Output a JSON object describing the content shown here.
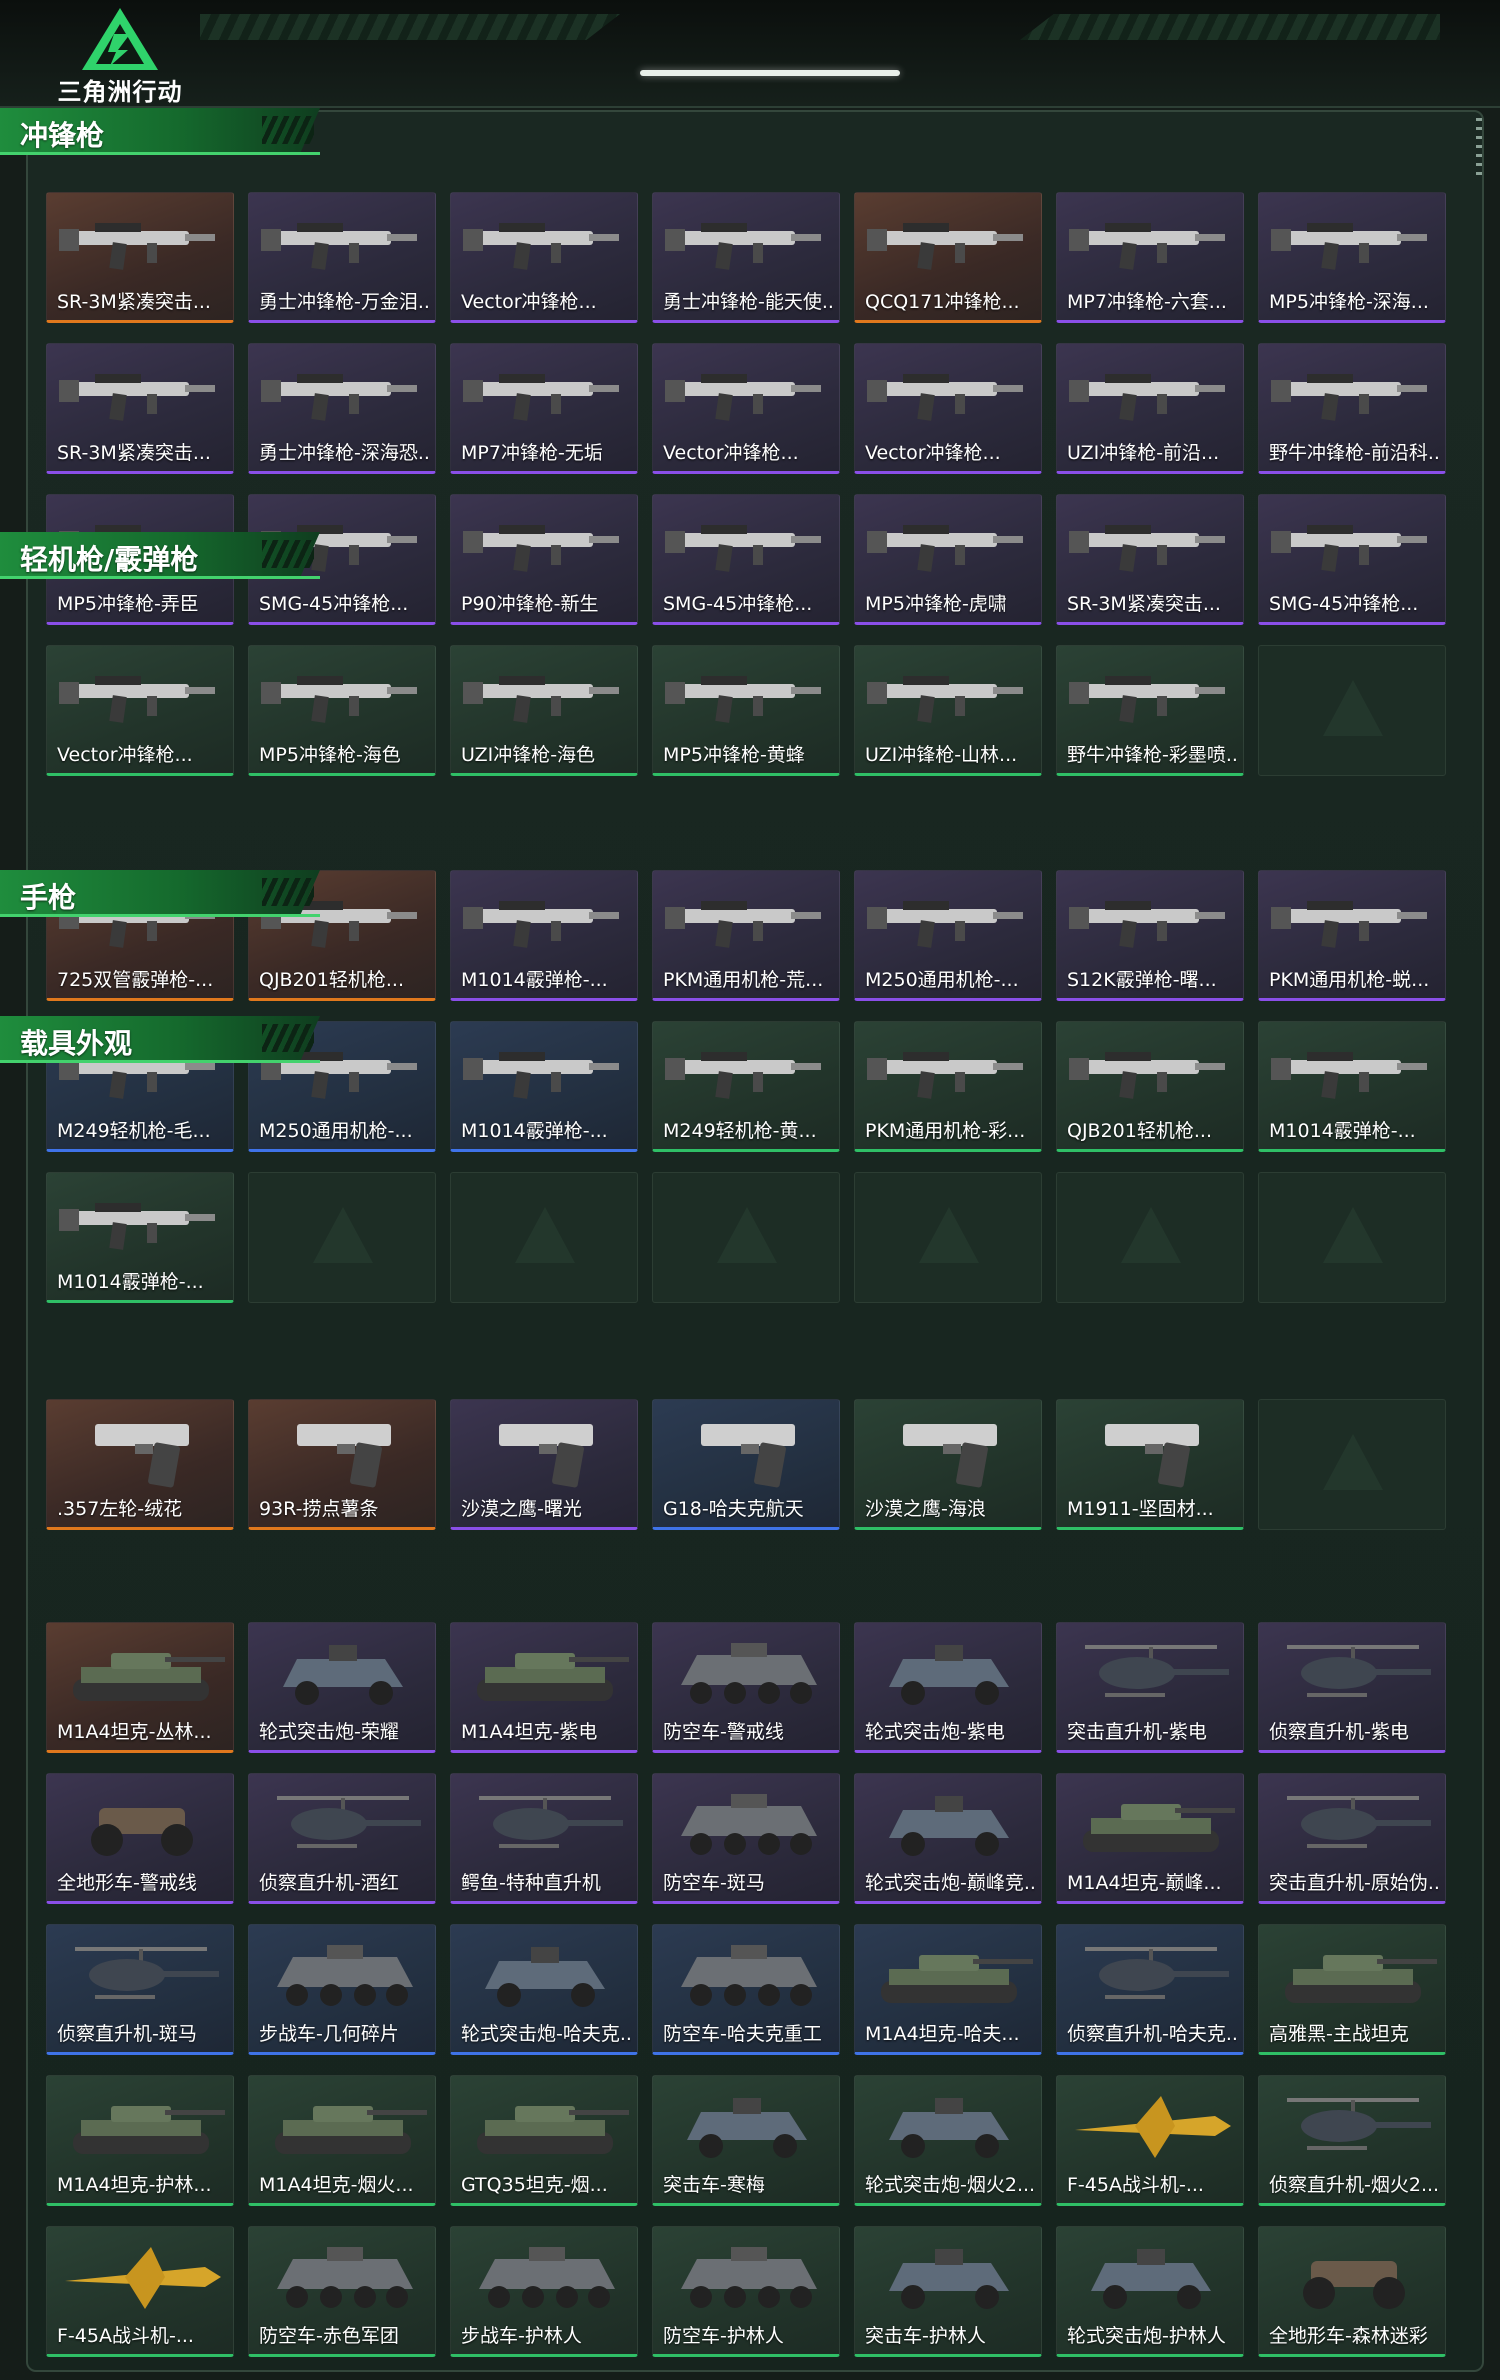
{
  "header": {
    "logo_text": "三角洲行动"
  },
  "colors": {
    "orange": "#e0781d",
    "purple": "#8a4fe8",
    "blue": "#3f73e8",
    "green": "#2fbf66",
    "accent": "#1f8d3d"
  },
  "sections": [
    {
      "title": "冲锋枪",
      "items": [
        {
          "name": "SR-3M紧凑突击...",
          "rarity": "orange",
          "icon": "rifle-icon"
        },
        {
          "name": "勇士冲锋枪-万金泪...",
          "rarity": "purple",
          "icon": "rifle-icon"
        },
        {
          "name": "Vector冲锋枪...",
          "rarity": "purple",
          "icon": "rifle-icon"
        },
        {
          "name": "勇士冲锋枪-能天使...",
          "rarity": "purple",
          "icon": "rifle-icon"
        },
        {
          "name": "QCQ171冲锋枪...",
          "rarity": "orange",
          "icon": "rifle-icon"
        },
        {
          "name": "MP7冲锋枪-六套...",
          "rarity": "purple",
          "icon": "rifle-icon"
        },
        {
          "name": "MP5冲锋枪-深海...",
          "rarity": "purple",
          "icon": "rifle-icon"
        },
        {
          "name": "SR-3M紧凑突击...",
          "rarity": "purple",
          "icon": "rifle-icon"
        },
        {
          "name": "勇士冲锋枪-深海恐...",
          "rarity": "purple",
          "icon": "rifle-icon"
        },
        {
          "name": "MP7冲锋枪-无垢",
          "rarity": "purple",
          "icon": "rifle-icon"
        },
        {
          "name": "Vector冲锋枪...",
          "rarity": "purple",
          "icon": "rifle-icon"
        },
        {
          "name": "Vector冲锋枪...",
          "rarity": "purple",
          "icon": "rifle-icon"
        },
        {
          "name": "UZI冲锋枪-前沿...",
          "rarity": "purple",
          "icon": "rifle-icon"
        },
        {
          "name": "野牛冲锋枪-前沿科...",
          "rarity": "purple",
          "icon": "rifle-icon"
        },
        {
          "name": "MP5冲锋枪-弄臣",
          "rarity": "purple",
          "icon": "rifle-icon"
        },
        {
          "name": "SMG-45冲锋枪...",
          "rarity": "purple",
          "icon": "rifle-icon"
        },
        {
          "name": "P90冲锋枪-新生",
          "rarity": "purple",
          "icon": "rifle-icon"
        },
        {
          "name": "SMG-45冲锋枪...",
          "rarity": "purple",
          "icon": "rifle-icon"
        },
        {
          "name": "MP5冲锋枪-虎啸",
          "rarity": "purple",
          "icon": "rifle-icon"
        },
        {
          "name": "SR-3M紧凑突击...",
          "rarity": "purple",
          "icon": "rifle-icon"
        },
        {
          "name": "SMG-45冲锋枪...",
          "rarity": "purple",
          "icon": "rifle-icon"
        },
        {
          "name": "Vector冲锋枪...",
          "rarity": "green",
          "icon": "rifle-icon"
        },
        {
          "name": "MP5冲锋枪-海色",
          "rarity": "green",
          "icon": "rifle-icon"
        },
        {
          "name": "UZI冲锋枪-海色",
          "rarity": "green",
          "icon": "rifle-icon"
        },
        {
          "name": "MP5冲锋枪-黄蜂",
          "rarity": "green",
          "icon": "rifle-icon"
        },
        {
          "name": "UZI冲锋枪-山林...",
          "rarity": "green",
          "icon": "rifle-icon"
        },
        {
          "name": "野牛冲锋枪-彩墨喷...",
          "rarity": "green",
          "icon": "rifle-icon"
        },
        {
          "name": "",
          "rarity": "empty",
          "icon": ""
        }
      ]
    },
    {
      "title": "轻机枪/霰弹枪",
      "items": [
        {
          "name": "725双管霰弹枪-...",
          "rarity": "orange",
          "icon": "rifle-icon"
        },
        {
          "name": "QJB201轻机枪...",
          "rarity": "orange",
          "icon": "rifle-icon"
        },
        {
          "name": "M1014霰弹枪-...",
          "rarity": "purple",
          "icon": "rifle-icon"
        },
        {
          "name": "PKM通用机枪-荒...",
          "rarity": "purple",
          "icon": "rifle-icon"
        },
        {
          "name": "M250通用机枪-...",
          "rarity": "purple",
          "icon": "rifle-icon"
        },
        {
          "name": "S12K霰弹枪-曙...",
          "rarity": "purple",
          "icon": "rifle-icon"
        },
        {
          "name": "PKM通用机枪-蜕...",
          "rarity": "purple",
          "icon": "rifle-icon"
        },
        {
          "name": "M249轻机枪-毛...",
          "rarity": "blue",
          "icon": "rifle-icon"
        },
        {
          "name": "M250通用机枪-...",
          "rarity": "blue",
          "icon": "rifle-icon"
        },
        {
          "name": "M1014霰弹枪-...",
          "rarity": "blue",
          "icon": "rifle-icon"
        },
        {
          "name": "M249轻机枪-黄...",
          "rarity": "green",
          "icon": "rifle-icon"
        },
        {
          "name": "PKM通用机枪-彩...",
          "rarity": "green",
          "icon": "rifle-icon"
        },
        {
          "name": "QJB201轻机枪...",
          "rarity": "green",
          "icon": "rifle-icon"
        },
        {
          "name": "M1014霰弹枪-...",
          "rarity": "green",
          "icon": "rifle-icon"
        },
        {
          "name": "M1014霰弹枪-...",
          "rarity": "green",
          "icon": "rifle-icon"
        },
        {
          "name": "",
          "rarity": "empty",
          "icon": ""
        },
        {
          "name": "",
          "rarity": "empty",
          "icon": ""
        },
        {
          "name": "",
          "rarity": "empty",
          "icon": ""
        },
        {
          "name": "",
          "rarity": "empty",
          "icon": ""
        },
        {
          "name": "",
          "rarity": "empty",
          "icon": ""
        },
        {
          "name": "",
          "rarity": "empty",
          "icon": ""
        }
      ]
    },
    {
      "title": "手枪",
      "items": [
        {
          "name": ".357左轮-绒花",
          "rarity": "orange",
          "icon": "pistol-icon"
        },
        {
          "name": "93R-捞点薯条",
          "rarity": "orange",
          "icon": "pistol-icon"
        },
        {
          "name": "沙漠之鹰-曙光",
          "rarity": "purple",
          "icon": "pistol-icon"
        },
        {
          "name": "G18-哈夫克航天",
          "rarity": "blue",
          "icon": "pistol-icon"
        },
        {
          "name": "沙漠之鹰-海浪",
          "rarity": "green",
          "icon": "pistol-icon"
        },
        {
          "name": "M1911-坚固材...",
          "rarity": "green",
          "icon": "pistol-icon"
        },
        {
          "name": "",
          "rarity": "empty",
          "icon": ""
        }
      ]
    },
    {
      "title": "载具外观",
      "items": [
        {
          "name": "M1A4坦克-丛林...",
          "rarity": "orange",
          "icon": "tank-icon"
        },
        {
          "name": "轮式突击炮-荣耀",
          "rarity": "purple",
          "icon": "armored-car-icon"
        },
        {
          "name": "M1A4坦克-紫电",
          "rarity": "purple",
          "icon": "tank-icon"
        },
        {
          "name": "防空车-警戒线",
          "rarity": "purple",
          "icon": "apc-icon"
        },
        {
          "name": "轮式突击炮-紫电",
          "rarity": "purple",
          "icon": "armored-car-icon"
        },
        {
          "name": "突击直升机-紫电",
          "rarity": "purple",
          "icon": "helicopter-icon"
        },
        {
          "name": "侦察直升机-紫电",
          "rarity": "purple",
          "icon": "helicopter-icon"
        },
        {
          "name": "全地形车-警戒线",
          "rarity": "purple",
          "icon": "atv-icon"
        },
        {
          "name": "侦察直升机-酒红",
          "rarity": "purple",
          "icon": "helicopter-icon"
        },
        {
          "name": "鳄鱼-特种直升机",
          "rarity": "purple",
          "icon": "helicopter-icon"
        },
        {
          "name": "防空车-斑马",
          "rarity": "purple",
          "icon": "apc-icon"
        },
        {
          "name": "轮式突击炮-巅峰竞...",
          "rarity": "purple",
          "icon": "armored-car-icon"
        },
        {
          "name": "M1A4坦克-巅峰...",
          "rarity": "purple",
          "icon": "tank-icon"
        },
        {
          "name": "突击直升机-原始伪...",
          "rarity": "purple",
          "icon": "helicopter-icon"
        },
        {
          "name": "侦察直升机-斑马",
          "rarity": "blue",
          "icon": "helicopter-icon"
        },
        {
          "name": "步战车-几何碎片",
          "rarity": "blue",
          "icon": "apc-icon"
        },
        {
          "name": "轮式突击炮-哈夫克...",
          "rarity": "blue",
          "icon": "armored-car-icon"
        },
        {
          "name": "防空车-哈夫克重工",
          "rarity": "blue",
          "icon": "apc-icon"
        },
        {
          "name": "M1A4坦克-哈夫...",
          "rarity": "blue",
          "icon": "tank-icon"
        },
        {
          "name": "侦察直升机-哈夫克...",
          "rarity": "blue",
          "icon": "helicopter-icon"
        },
        {
          "name": "高雅黑-主战坦克",
          "rarity": "green",
          "icon": "tank-icon"
        },
        {
          "name": "M1A4坦克-护林...",
          "rarity": "green",
          "icon": "tank-icon"
        },
        {
          "name": "M1A4坦克-烟火...",
          "rarity": "green",
          "icon": "tank-icon"
        },
        {
          "name": "GTQ35坦克-烟...",
          "rarity": "green",
          "icon": "tank-icon"
        },
        {
          "name": "突击车-寒梅",
          "rarity": "green",
          "icon": "armored-car-icon"
        },
        {
          "name": "轮式突击炮-烟火2...",
          "rarity": "green",
          "icon": "armored-car-icon"
        },
        {
          "name": "F-45A战斗机-...",
          "rarity": "green",
          "icon": "jet-icon"
        },
        {
          "name": "侦察直升机-烟火2...",
          "rarity": "green",
          "icon": "helicopter-icon"
        },
        {
          "name": "F-45A战斗机-...",
          "rarity": "green",
          "icon": "jet-icon"
        },
        {
          "name": "防空车-赤色军团",
          "rarity": "green",
          "icon": "apc-icon"
        },
        {
          "name": "步战车-护林人",
          "rarity": "green",
          "icon": "apc-icon"
        },
        {
          "name": "防空车-护林人",
          "rarity": "green",
          "icon": "apc-icon"
        },
        {
          "name": "突击车-护林人",
          "rarity": "green",
          "icon": "armored-car-icon"
        },
        {
          "name": "轮式突击炮-护林人",
          "rarity": "green",
          "icon": "armored-car-icon"
        },
        {
          "name": "全地形车-森林迷彩",
          "rarity": "green",
          "icon": "atv-icon"
        }
      ]
    }
  ]
}
